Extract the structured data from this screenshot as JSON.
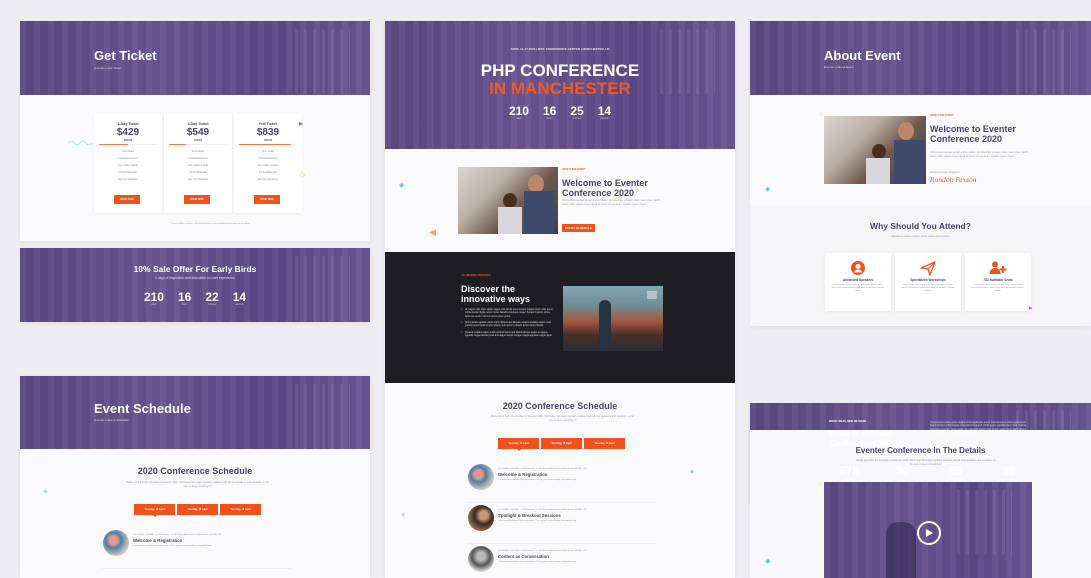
{
  "ticket_page": {
    "title": "Get Ticket",
    "breadcrumb": "Eventer » Get Ticket",
    "tickets": [
      {
        "name": "1-Day Ticket",
        "price": "$429",
        "sold": "250/500",
        "sold_fraction": 0.5,
        "features": [
          "Front Seats",
          "Unlimited Entrance",
          "Free Coffee Snacks",
          "Printed Materials",
          "Day One Workshop"
        ],
        "button": "BOOK NOW"
      },
      {
        "name": "2-Day Ticket",
        "price": "$549",
        "sold": "150/500",
        "sold_fraction": 0.3,
        "features": [
          "Front Seats",
          "Unlimited Entrance",
          "Free Coffee Snacks",
          "Printed Materials",
          "Day One Workshop"
        ],
        "button": "BOOK NOW"
      },
      {
        "name": "Full Ticket",
        "price": "$839",
        "sold": "450/500",
        "sold_fraction": 0.9,
        "features": [
          "Front Seats",
          "Unlimited Entrance",
          "Free Coffee Snacks",
          "Printed Materials",
          "Day One Workshop"
        ],
        "button": "BOOK NOW"
      }
    ],
    "footnote": "* Ticket holders receive a full refund if they cancel within the first week of purchase."
  },
  "sale_banner": {
    "title": "10% Sale Offer For Early Birds",
    "subtitle": "4 days of inspiration and education on user experience",
    "countdown": [
      {
        "value": "210",
        "label": "days"
      },
      {
        "value": "16",
        "label": "hours"
      },
      {
        "value": "22",
        "label": "minutes"
      },
      {
        "value": "14",
        "label": "seconds"
      }
    ]
  },
  "schedule_page": {
    "title": "Event Schedule",
    "breadcrumb": "Eventer » Event Schedule",
    "section_title": "2020 Conference Schedule",
    "section_desc": "Below you'll find the schedule for Eventer 2020. We'll keep this page regularly updated with all new speakers and sessions, so be sure to keep checking in!",
    "tabs": [
      "Tuesday, 14 April",
      "Tuesday, 15 April",
      "Tuesday, 16 April"
    ],
    "items": [
      {
        "time": "8:45 AM - 9:00 AM",
        "speaker": "R.Peterson",
        "location": "125 Some Awesome St, Manchester M4 3BL, UK",
        "title": "Welcome & Registration",
        "desc": "Continental breakfast and registration. Pick up your name badge and goodie bag."
      }
    ]
  },
  "home_page": {
    "hero_meta": "APRIL 14-17 2020 | WST. CONFERENCE CENTER | MANCHESTER, UK",
    "hero_title_line1": "PHP CONFERENCE",
    "hero_title_line2": "IN MANCHESTER",
    "countdown": [
      {
        "value": "210",
        "label": "days"
      },
      {
        "value": "16",
        "label": "hours"
      },
      {
        "value": "25",
        "label": "minutes"
      },
      {
        "value": "14",
        "label": "seconds"
      }
    ],
    "about_eyebrow": "ABOUT THE EVENT",
    "about_title": "Welcome to Eventer Conference 2020",
    "about_text": "Cursus risus laoreet auctor, varius augue. At nulla dolor a sapien risus, nec luctus mauris donec diam sapien neque ligula at ipsum lacinia quam sodales sapien vitae.",
    "about_button": "EVENT SCHEDULE",
    "discover_eyebrow": "AN AMAZING PROGRAM",
    "discover_title": "Discover the innovative ways",
    "discover_bullets": [
      "At magna nulla dolor sapien augue erat iaculis purus tempor magna ipsum vitae purus primis pretium ligula rutrum luctus blandit porta justo integer. Feugiat a primis ultrice ligula nec auctor rhoncus purus ipsum primis.",
      "Nemo ipsam egestas volute turpis dolores and aliquam quaerat sodales sapien undo pretium purus ligula tempus ipsum undo auctor a mauris lectus ipsum blandit.",
      "Quaerat sodales sapien undo euismod purus and blandit laoreet augue an augue egestas. Augue iaculis purus and augue tempor congue magna egestas magna ligula."
    ],
    "schedule_title": "2020 Conference Schedule",
    "schedule_desc": "Below you'll find the schedule for Eventer 2020. We'll keep this page regularly updated with all new speakers and sessions, so be sure to keep checking in!",
    "schedule_tabs": [
      "Tuesday, 14 April",
      "Tuesday, 15 April",
      "Tuesday, 16 April"
    ],
    "schedule_items": [
      {
        "time": "8:45 AM - 9:00 AM",
        "speaker": "R.Peterson",
        "location": "125 Some Awesome St, Manchester M4 3BL, UK",
        "title": "Welcome & Registration",
        "desc": "Continental breakfast and registration. Pick up your name badge and goodie bag."
      },
      {
        "time": "8:45 AM - 9:00 AM",
        "speaker": "R.Peterson",
        "location": "125 Some Awesome St, Manchester M4 3BL, UK",
        "title": "Spotlight & Breakout Sessions",
        "desc": "Continental breakfast and registration. Pick up your name badge and goodie bag."
      },
      {
        "time": "8:45 AM - 9:00 AM",
        "speaker": "R.Peterson",
        "location": "125 Some Awesome St, Manchester M4 3BL, UK",
        "title": "Content as Conversation",
        "desc": "Continental breakfast and registration. Pick up your name badge and goodie bag."
      }
    ]
  },
  "about_page": {
    "title": "About Event",
    "breadcrumb": "Eventer » About Event",
    "eyebrow": "ABOUT THE EVENT",
    "welcome_title": "Welcome to Eventer Conference 2020",
    "welcome_text": "Cursus risus laoreet auctor, varius augue. At nulla dolor a sapien risus, nec luctus mauris donec diam sapien neque ligula at ipsum lacinia quam sodales sapien vitae.",
    "organizer": "Randon Pexson, Organizer",
    "signature": "Randon Pexson",
    "why_title": "Why Should You Attend?",
    "why_subtitle": "Aliquam a augue suscipit, luctus neque purus ipsum",
    "features": [
      {
        "icon": "user-circle-icon",
        "title": "Advanced Speakers",
        "desc": "Porta semper lacus cursus, feugiat primis ultrice a ligula risus auctor tempus undo feugiat dolor lacinia dolor, dolores, blandit."
      },
      {
        "icon": "paper-plane-icon",
        "title": "Specialized Workshops",
        "desc": "Porta semper lacus cursus, feugiat primis ultrice a ligula risus auctor tempus undo feugiat dolor lacinia dolor, dolores, blandit."
      },
      {
        "icon": "user-plus-icon",
        "title": "752 Available Seats",
        "desc": "Porta semper lacus cursus, feugiat primis ultrice a ligula risus auctor tempus undo feugiat dolor lacinia dolor, dolores, blandit."
      }
    ],
    "what_eyebrow": "FRESH IDEAS, NEW METHODS",
    "what_title": "What is Eventer Conference 2020?",
    "what_text": "Tempor lacus cursus porta, feugiat primis ligula risus auctor and rhoncus in ultrice ligula purus ipsum primis in cubilia augue vitae laoreet augue in cubilia augue egestas ipsum vitae. Cursus risus laoreet auctor, varius augue. At nulla dolor sapien risus luctus mauris donec diam sapien neque ligula ipsum volute ruanto quaerat sodales sapien vitae donec enim ipsum porta justo integer at velna vitae auctor magna at risus.",
    "stats": [
      {
        "value": "678",
        "label": "Participants"
      },
      {
        "value": "30",
        "label": "Speakers"
      },
      {
        "value": "55",
        "label": "Hours of Content"
      },
      {
        "value": "39",
        "label": "Workshops"
      }
    ],
    "details_title": "Eventer Conference In The Details",
    "details_desc": "Below you'll find the schedule for Eventer 2020. We'll keep this page regularly updated with all new speakers and sessions, so be sure to keep checking in!"
  },
  "colors": {
    "brand_purple": "#5c4a86",
    "accent_orange": "#f0521c",
    "heading_navy": "#4b3f78",
    "dark_section": "#1e1e22"
  }
}
